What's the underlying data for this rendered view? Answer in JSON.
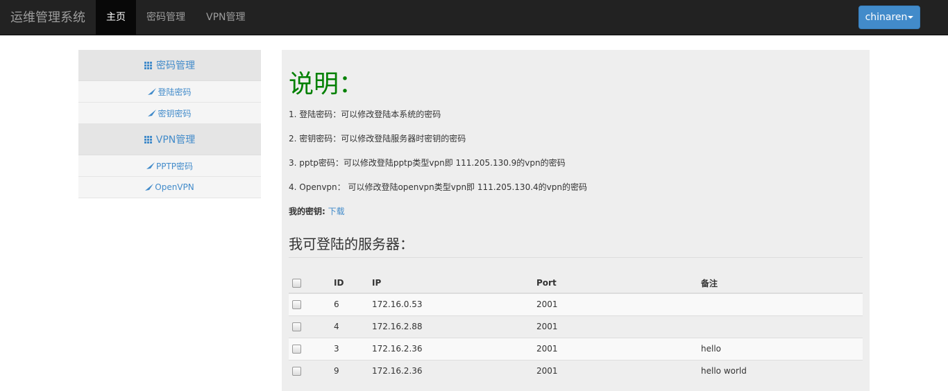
{
  "navbar": {
    "brand": "运维管理系统",
    "items": [
      "主页",
      "密码管理",
      "VPN管理"
    ],
    "user": "chinaren"
  },
  "sidebar": {
    "groups": [
      {
        "title": "密码管理",
        "items": [
          "登陆密码",
          "密钥密码"
        ]
      },
      {
        "title": "VPN管理",
        "items": [
          "PPTP密码",
          "OpenVPN"
        ]
      }
    ]
  },
  "main": {
    "title": "说明：",
    "lines": [
      "1. 登陆密码：可以修改登陆本系统的密码",
      "2. 密钥密码：可以修改登陆服务器时密钥的密码",
      "3. pptp密码：可以修改登陆pptp类型vpn即 111.205.130.9的vpn的密码",
      "4. Openvpn： 可以修改登陆openvpn类型vpn即 111.205.130.4的vpn的密码"
    ],
    "key_label": "我的密钥:",
    "key_link": "下载",
    "servers_title": "我可登陆的服务器：",
    "table": {
      "headers": [
        "ID",
        "IP",
        "Port",
        "备注"
      ],
      "rows": [
        [
          "6",
          "172.16.0.53",
          "2001",
          ""
        ],
        [
          "4",
          "172.16.2.88",
          "2001",
          ""
        ],
        [
          "3",
          "172.16.2.36",
          "2001",
          "hello"
        ],
        [
          "9",
          "172.16.2.36",
          "2001",
          "hello world"
        ]
      ]
    }
  },
  "colors": {
    "accent": "#428bca",
    "title_green": "#008000",
    "navbar": "#222222"
  }
}
